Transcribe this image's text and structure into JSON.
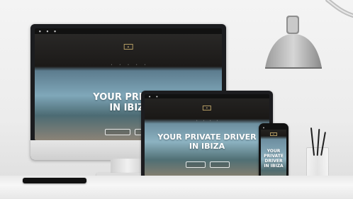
{
  "scene": {
    "monitor": {
      "hero_title_line1": "YOUR PRIVATE",
      "hero_title_line2": "IN IBIZA"
    },
    "laptop": {
      "hero_title_line1": "YOUR PRIVATE DRIVER",
      "hero_title_line2": "IN IBIZA"
    },
    "phone": {
      "hero_title_lines": [
        "YOUR",
        "PRIVATE",
        "DRIVER",
        "IN IBIZA"
      ]
    }
  },
  "colors": {
    "accent_gold": "#b39b62",
    "site_dark": "#1b1917",
    "sea": "#7fa7b9"
  }
}
